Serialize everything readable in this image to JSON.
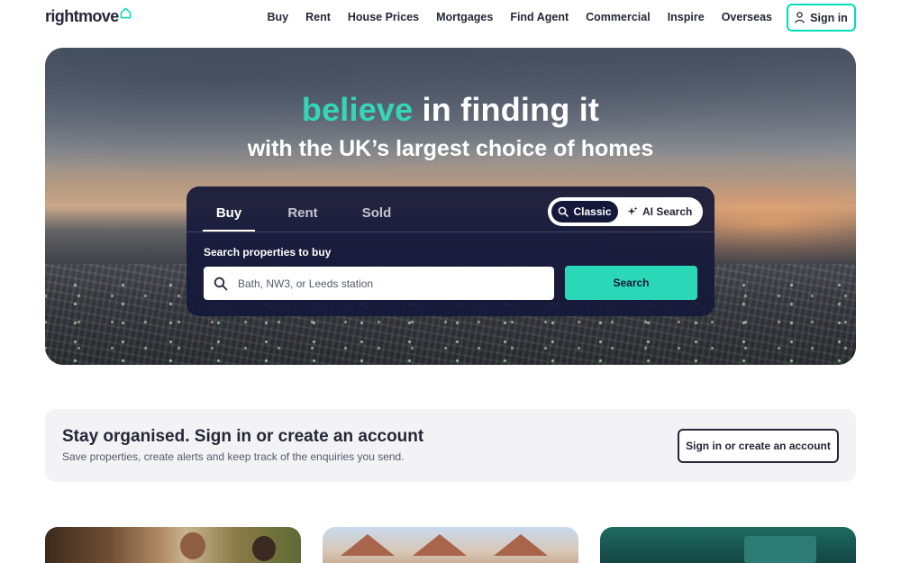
{
  "brand": {
    "name": "rightmove",
    "accent_color": "#00deb6",
    "logo_icon": "house-outline-icon"
  },
  "nav": {
    "links": [
      "Buy",
      "Rent",
      "House Prices",
      "Mortgages",
      "Find Agent",
      "Commercial",
      "Inspire",
      "Overseas"
    ],
    "sign_in": {
      "label": "Sign in",
      "icon": "user-icon"
    }
  },
  "hero": {
    "headline_accent": "believe",
    "headline_rest": " in finding it",
    "subhead": "with the UK’s largest choice of homes"
  },
  "search": {
    "tabs": [
      "Buy",
      "Rent",
      "Sold"
    ],
    "active_tab": "Buy",
    "mode_toggle": {
      "classic": "Classic",
      "ai": "AI Search",
      "active": "Classic"
    },
    "label": "Search properties to buy",
    "placeholder": "Bath, NW3, or Leeds station",
    "button": "Search"
  },
  "account_banner": {
    "title": "Stay organised. Sign in or create an account",
    "text": "Save properties, create alerts and keep track of the enquiries you send.",
    "button": "Sign in or create an account"
  },
  "colors": {
    "navy": "#15183a",
    "teal": "#2ad8b8",
    "text": "#262637"
  }
}
